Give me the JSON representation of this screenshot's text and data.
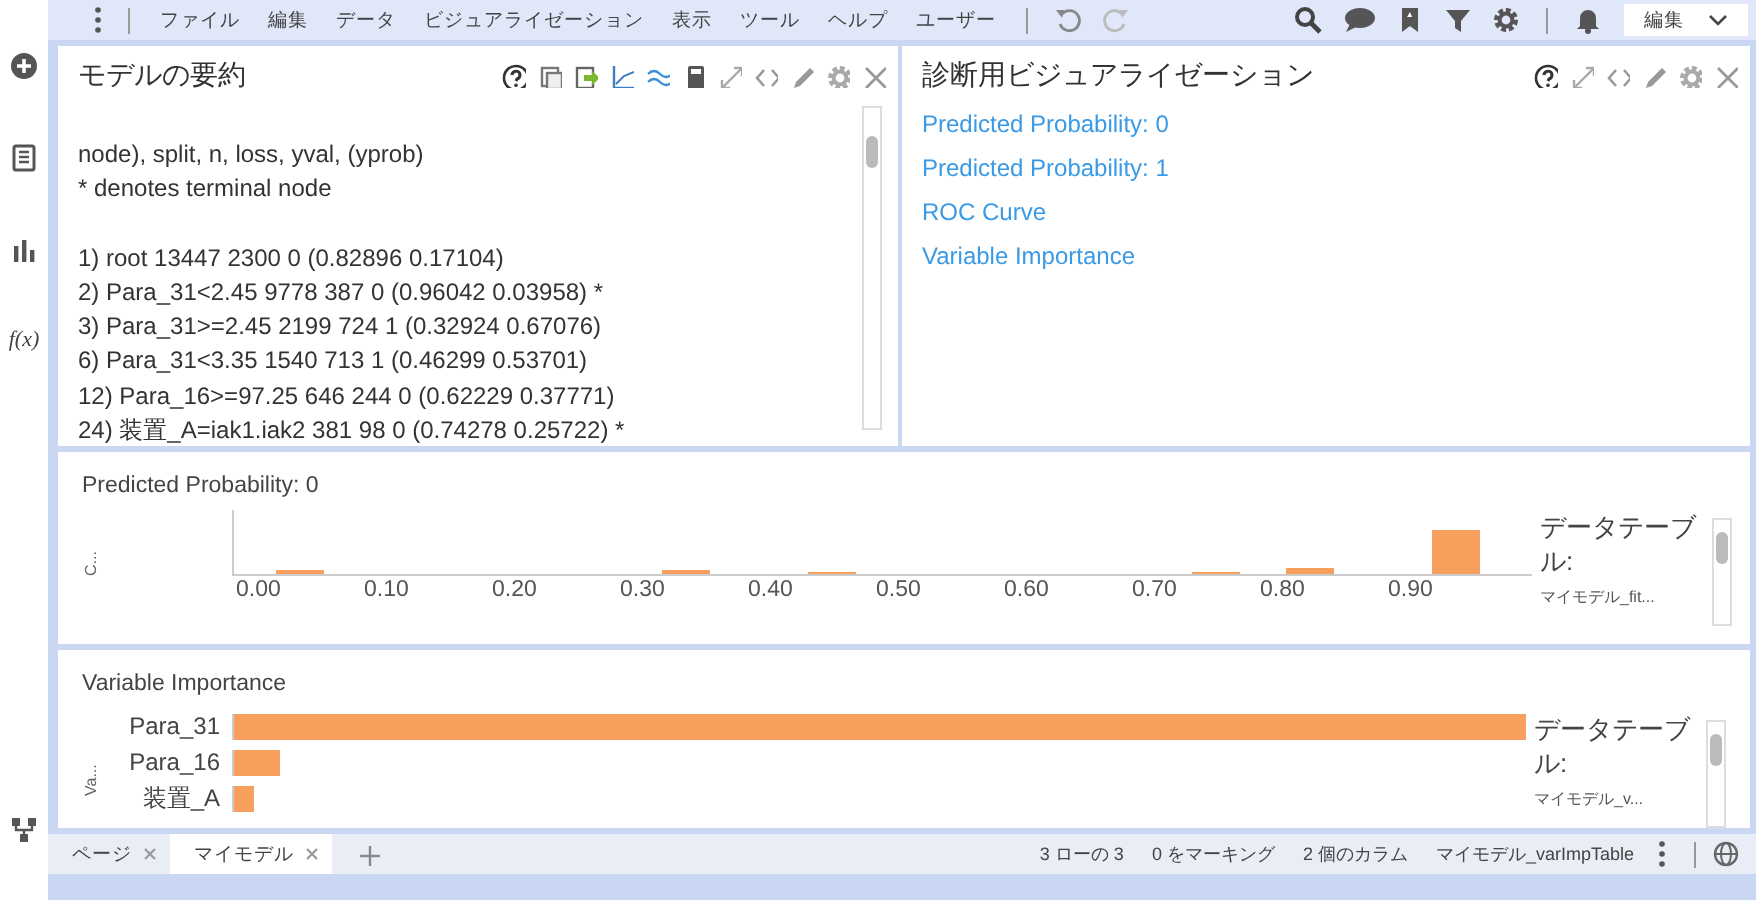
{
  "menu_bar": {
    "items": [
      "ファイル",
      "編集",
      "データ",
      "ビジュアライゼーション",
      "表示",
      "ツール",
      "ヘルプ",
      "ユーザー"
    ],
    "view_select": "編集"
  },
  "sidebar": {
    "function_label": "f(x)"
  },
  "summary_panel": {
    "title": "モデルの要約",
    "header_lines": [
      "node), split, n, loss, yval, (yprob)",
      "* denotes terminal node"
    ],
    "node_lines": [
      "1) root 13447 2300 0 (0.82896 0.17104)",
      "2) Para_31<2.45 9778 387 0 (0.96042 0.03958) *",
      "3) Para_31>=2.45 2199 724 1 (0.32924 0.67076)",
      "6) Para_31<3.35 1540 713 1 (0.46299 0.53701)",
      "12) Para_16>=97.25 646 244 0 (0.62229 0.37771)",
      "24) 装置_A=iak1.iak2 381 98 0 (0.74278 0.25722) *"
    ]
  },
  "diagnostics_panel": {
    "title": "診断用ビジュアライゼーション",
    "links": [
      "Predicted Probability: 0",
      "Predicted Probability: 1",
      "ROC Curve",
      "Variable Importance"
    ]
  },
  "histogram_panel": {
    "title": "Predicted Probability: 0",
    "y_label": "C...",
    "x_ticks": [
      "0.00",
      "0.10",
      "0.20",
      "0.30",
      "0.40",
      "0.50",
      "0.60",
      "0.70",
      "0.80",
      "0.90"
    ],
    "legend": {
      "title": "データテーブル:",
      "value": "マイモデル_fit..."
    }
  },
  "importance_panel": {
    "title": "Variable Importance",
    "y_label": "Va...",
    "bars": [
      {
        "label": "Para_31",
        "level": 1
      },
      {
        "label": "Para_16",
        "level": 0.035
      },
      {
        "label": "装置_A",
        "level": 0.016
      }
    ],
    "legend": {
      "title": "データテーブル:",
      "value": "マイモデル_v..."
    }
  },
  "page_tabs": [
    {
      "label": "ページ",
      "selected": false
    },
    {
      "label": "マイモデル",
      "selected": true
    }
  ],
  "status_bar": {
    "items": [
      "3 ローの 3",
      "0 をマーキング",
      "2 個のカラム",
      "マイモデル_varImpTable"
    ]
  }
}
